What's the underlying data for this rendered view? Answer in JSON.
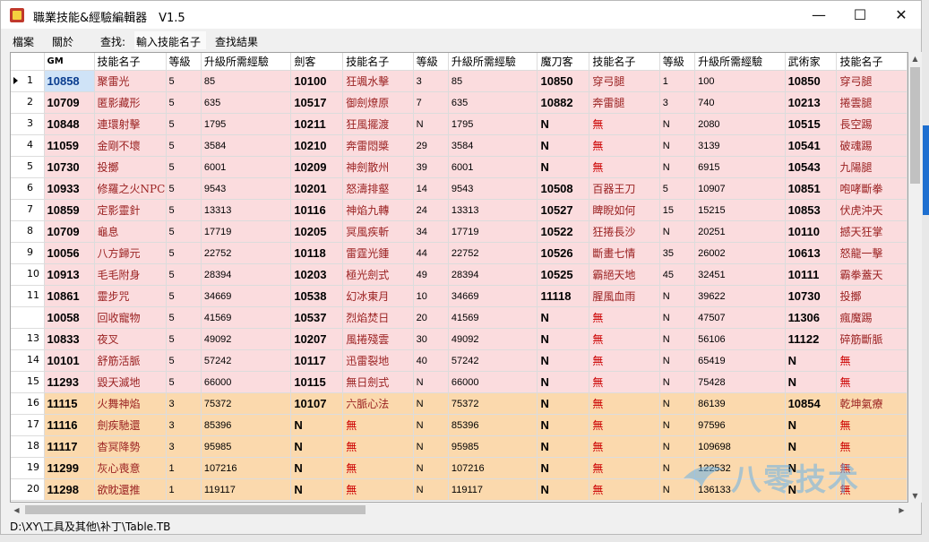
{
  "window": {
    "title": "職業技能&經驗編輯器　V1.5"
  },
  "menu": {
    "file": "檔案",
    "about": "關於",
    "search_label": "查找:",
    "search_placeholder": "輸入技能名子",
    "search_results": "查找結果"
  },
  "columns": [
    "GM",
    "技能名子",
    "等級",
    "升級所需經驗",
    "劍客",
    "技能名子",
    "等級",
    "升級所需經驗",
    "魔刀客",
    "技能名子",
    "等級",
    "升級所需經驗",
    "武術家",
    "技能名子"
  ],
  "rows": [
    {
      "n": "1",
      "c": [
        "10858",
        "聚雷光",
        "5",
        "85",
        "10100",
        "狂颯水擊",
        "3",
        "85",
        "10850",
        "穿弓腿",
        "1",
        "100",
        "10850",
        "穿弓腿"
      ],
      "style": "pink",
      "sel": true
    },
    {
      "n": "2",
      "c": [
        "10709",
        "匿影藏形",
        "5",
        "635",
        "10517",
        "御劍燎原",
        "7",
        "635",
        "10882",
        "奔雷腿",
        "3",
        "740",
        "10213",
        "捲雲腿"
      ],
      "style": "pink"
    },
    {
      "n": "3",
      "c": [
        "10848",
        "連環射擊",
        "5",
        "1795",
        "10211",
        "狂風擺渡",
        "N",
        "1795",
        "N",
        "無",
        "N",
        "2080",
        "10515",
        "長空踢"
      ],
      "style": "pink"
    },
    {
      "n": "4",
      "c": [
        "11059",
        "金剛不壞",
        "5",
        "3584",
        "10210",
        "奔雷悶槳",
        "29",
        "3584",
        "N",
        "無",
        "N",
        "3139",
        "10541",
        "破魂踢"
      ],
      "style": "pink"
    },
    {
      "n": "5",
      "c": [
        "10730",
        "投擲",
        "5",
        "6001",
        "10209",
        "神劍散州",
        "39",
        "6001",
        "N",
        "無",
        "N",
        "6915",
        "10543",
        "九陽腿"
      ],
      "style": "pink"
    },
    {
      "n": "6",
      "c": [
        "10933",
        "修羅之火NPC",
        "5",
        "9543",
        "10201",
        "怒濤排壑",
        "14",
        "9543",
        "10508",
        "百器王刀",
        "5",
        "10907",
        "10851",
        "咆哮斷拳"
      ],
      "style": "pink"
    },
    {
      "n": "7",
      "c": [
        "10859",
        "定影靈針",
        "5",
        "13313",
        "10116",
        "神焰九轉",
        "24",
        "13313",
        "10527",
        "睥睨如何",
        "15",
        "15215",
        "10853",
        "伏虎沖天"
      ],
      "style": "pink"
    },
    {
      "n": "8",
      "c": [
        "10709",
        "龜息",
        "5",
        "17719",
        "10205",
        "冥風疾斬",
        "34",
        "17719",
        "10522",
        "狂捲長沙",
        "N",
        "20251",
        "10110",
        "撼天狂掌"
      ],
      "style": "pink"
    },
    {
      "n": "9",
      "c": [
        "10056",
        "八方歸元",
        "5",
        "22752",
        "10118",
        "雷霆光鍾",
        "44",
        "22752",
        "10526",
        "斷畫七情",
        "35",
        "26002",
        "10613",
        "怒龍一擊"
      ],
      "style": "pink"
    },
    {
      "n": "10",
      "c": [
        "10913",
        "毛毛附身",
        "5",
        "28394",
        "10203",
        "極光劍式",
        "49",
        "28394",
        "10525",
        "霸絕天地",
        "45",
        "32451",
        "10111",
        "霸拳蓋天"
      ],
      "style": "pink"
    },
    {
      "n": "11",
      "c": [
        "10861",
        "靈步咒",
        "5",
        "34669",
        "10538",
        "幻冰東月",
        "10",
        "34669",
        "11118",
        "腥風血雨",
        "N",
        "39622",
        "10730",
        "投擲"
      ],
      "style": "pink"
    },
    {
      "n": "",
      "c": [
        "10058",
        "回收寵物",
        "5",
        "41569",
        "10537",
        "烈焰焚日",
        "20",
        "41569",
        "N",
        "無",
        "N",
        "47507",
        "11306",
        "瘋魔踢"
      ],
      "style": "pink"
    },
    {
      "n": "13",
      "c": [
        "10833",
        "夜叉",
        "5",
        "49092",
        "10207",
        "風捲殘雲",
        "30",
        "49092",
        "N",
        "無",
        "N",
        "56106",
        "11122",
        "碎筋斷脈"
      ],
      "style": "pink"
    },
    {
      "n": "14",
      "c": [
        "10101",
        "舒筋活脈",
        "5",
        "57242",
        "10117",
        "迅雷裂地",
        "40",
        "57242",
        "N",
        "無",
        "N",
        "65419",
        "N",
        "無"
      ],
      "style": "pink"
    },
    {
      "n": "15",
      "c": [
        "11293",
        "毀天滅地",
        "5",
        "66000",
        "10115",
        "無日劍式",
        "N",
        "66000",
        "N",
        "無",
        "N",
        "75428",
        "N",
        "無"
      ],
      "style": "pink"
    },
    {
      "n": "16",
      "c": [
        "11115",
        "火舞神焰",
        "3",
        "75372",
        "10107",
        "六脈心法",
        "N",
        "75372",
        "N",
        "無",
        "N",
        "86139",
        "10854",
        "乾坤氣療"
      ],
      "style": "orange"
    },
    {
      "n": "17",
      "c": [
        "11116",
        "劍疾馳還",
        "3",
        "85396",
        "N",
        "無",
        "N",
        "85396",
        "N",
        "無",
        "N",
        "97596",
        "N",
        "無"
      ],
      "style": "orange"
    },
    {
      "n": "18",
      "c": [
        "11117",
        "杳冥降勢",
        "3",
        "95985",
        "N",
        "無",
        "N",
        "95985",
        "N",
        "無",
        "N",
        "109698",
        "N",
        "無"
      ],
      "style": "orange"
    },
    {
      "n": "19",
      "c": [
        "11299",
        "灰心喪意",
        "1",
        "107216",
        "N",
        "無",
        "N",
        "107216",
        "N",
        "無",
        "N",
        "122532",
        "N",
        "無"
      ],
      "style": "orange"
    },
    {
      "n": "20",
      "c": [
        "11298",
        "欲眈還推",
        "1",
        "119117",
        "N",
        "無",
        "N",
        "119117",
        "N",
        "無",
        "N",
        "136133",
        "N",
        "無"
      ],
      "style": "orange"
    }
  ],
  "status": {
    "path": "D:\\XY\\工具及其他\\补丁\\Table.TB"
  },
  "watermark": {
    "text": "八零技术"
  },
  "icons": {
    "arrow": "current-row-arrow-icon",
    "minimize": "minimize-icon",
    "maximize": "maximize-icon",
    "close": "close-icon"
  }
}
